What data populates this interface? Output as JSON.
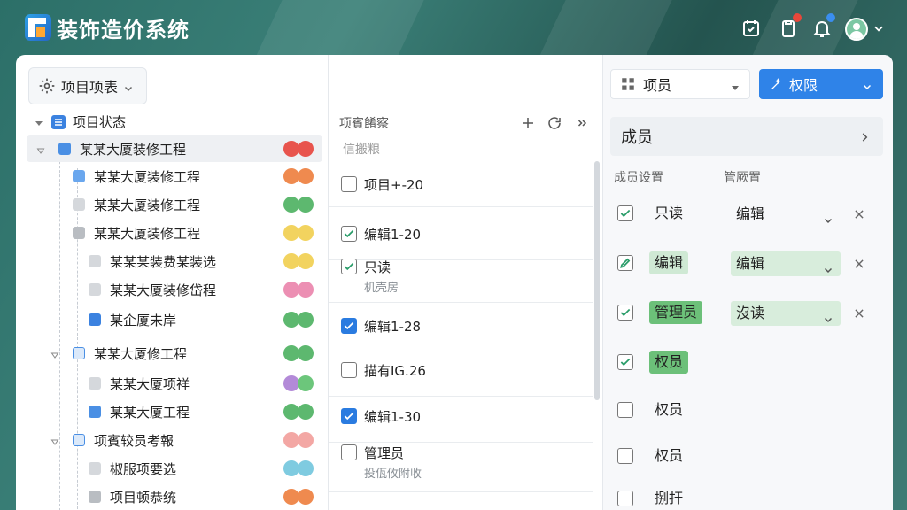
{
  "app": {
    "title": "装饰造价系统"
  },
  "left": {
    "project_select": "项目项表",
    "root": "项目状态",
    "items": [
      {
        "label": "某某大厦装修工程",
        "c1": "#e8544d",
        "c2": "#e8544d"
      },
      {
        "label": "某某大厦装修工程",
        "c1": "#ef8a4f",
        "c2": "#ef8a4f"
      },
      {
        "label": "某某大厦装修工程",
        "c1": "#5db86f",
        "c2": "#5db86f"
      },
      {
        "label": "某某大厦装修工程",
        "c1": "#f2d35f",
        "c2": "#f2d35f"
      },
      {
        "label": "某某某装费某装选",
        "c1": "#f2d35f",
        "c2": "#f2d35f"
      },
      {
        "label": "某某大厦装修岱程",
        "c1": "#ec8fb3",
        "c2": "#ec8fb3"
      },
      {
        "label": "某企厦未岸",
        "c1": "#5db86f",
        "c2": "#5db86f"
      },
      {
        "label": "某某大厦修工程",
        "c1": "#5db86f",
        "c2": "#5db86f"
      },
      {
        "label": "某某大厦项祥",
        "c1": "#b38ad8",
        "c2": "#6cc67b"
      },
      {
        "label": "某某大厦工程",
        "c1": "#5db86f",
        "c2": "#5db86f"
      },
      {
        "label": "项賓较员考報",
        "c1": "#f3a7a4",
        "c2": "#f3a7a4"
      },
      {
        "label": "椒服项要选",
        "c1": "#7fcbe0",
        "c2": "#7fcbe0"
      },
      {
        "label": "项目顿恭统",
        "c1": "#ef8a4f",
        "c2": "#ef8a4f"
      }
    ]
  },
  "middle": {
    "header": "项賓餚察",
    "sub": "信搬粮",
    "items": [
      {
        "label": "项目+-20",
        "sub": "",
        "state": "none"
      },
      {
        "label": "编辑1-20",
        "sub": "",
        "state": "check"
      },
      {
        "label": "只读",
        "sub": "机壳房",
        "state": "check"
      },
      {
        "label": "编辑1-28",
        "sub": "",
        "state": "blue"
      },
      {
        "label": "描有IG.26",
        "sub": "",
        "state": "none"
      },
      {
        "label": "编辑1-30",
        "sub": "",
        "state": "blue"
      },
      {
        "label": "管理员",
        "sub": "投佤攸附收",
        "state": "none"
      }
    ]
  },
  "right": {
    "member_select": "项员",
    "perm_button": "权限",
    "members_title": "成员",
    "col_a": "成员设置",
    "col_b": "管厥置",
    "rows": [
      {
        "label": "只读",
        "style": "plain",
        "value": "编辑",
        "vstyle": "plain",
        "check": "check",
        "remove": true
      },
      {
        "label": "编辑",
        "style": "lg",
        "value": "编辑",
        "vstyle": "green",
        "check": "edit",
        "remove": true
      },
      {
        "label": "管理员",
        "style": "dg",
        "value": "沒读",
        "vstyle": "green",
        "check": "check",
        "remove": true
      },
      {
        "label": "权员",
        "style": "dg",
        "value": "",
        "vstyle": "none",
        "check": "check",
        "remove": false
      },
      {
        "label": "权员",
        "style": "plain",
        "value": "",
        "vstyle": "none",
        "check": "none",
        "remove": false
      },
      {
        "label": "权员",
        "style": "plain",
        "value": "",
        "vstyle": "none",
        "check": "none",
        "remove": false
      },
      {
        "label": "捌扞",
        "style": "plain",
        "value": "",
        "vstyle": "none",
        "check": "none",
        "remove": false
      }
    ]
  }
}
